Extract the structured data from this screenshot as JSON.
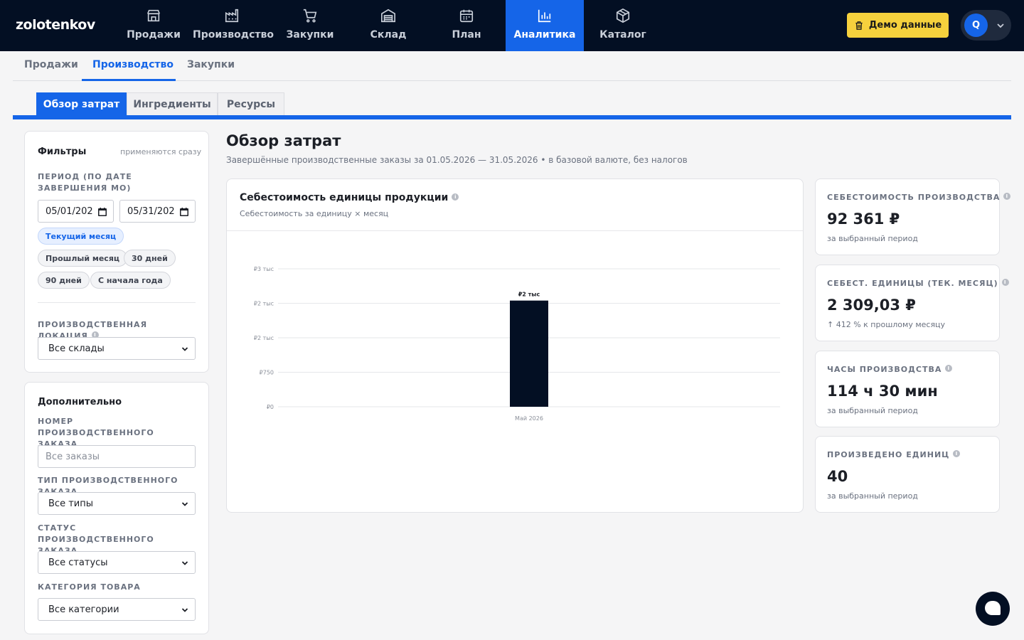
{
  "app": {
    "logo": "zolotenkov"
  },
  "nav": {
    "items": [
      {
        "label": "Продажи",
        "icon": "store-icon"
      },
      {
        "label": "Производство",
        "icon": "factory-icon"
      },
      {
        "label": "Закупки",
        "icon": "cart-icon"
      },
      {
        "label": "Склад",
        "icon": "warehouse-icon"
      },
      {
        "label": "План",
        "icon": "calendar-icon"
      },
      {
        "label": "Аналитика",
        "icon": "bar-chart-icon",
        "active": true
      },
      {
        "label": "Каталог",
        "icon": "box-icon"
      }
    ],
    "demo_button": "Демо данные",
    "user_initial": "Q"
  },
  "subtabs": [
    {
      "label": "Продажи"
    },
    {
      "label": "Производство",
      "active": true
    },
    {
      "label": "Закупки"
    }
  ],
  "tertabs": [
    {
      "label": "Обзор затрат",
      "active": true
    },
    {
      "label": "Ингредиенты"
    },
    {
      "label": "Ресурсы"
    }
  ],
  "filters": {
    "title": "Фильтры",
    "hint": "применяются сразу",
    "period_label": "ПЕРИОД (ПО ДАТЕ ЗАВЕРШЕНИЯ МО)",
    "date_from": "05/01/202",
    "date_to": "05/31/202",
    "presets": [
      {
        "label": "Текущий месяц",
        "active": true
      },
      {
        "label": "Прошлый месяц"
      },
      {
        "label": "30 дней"
      },
      {
        "label": "90 дней"
      },
      {
        "label": "С начала года"
      }
    ],
    "location_label": "ПРОИЗВОДСТВЕННАЯ ЛОКАЦИЯ",
    "location_value": "Все склады"
  },
  "extra": {
    "title": "Дополнительно",
    "order_number_label": "НОМЕР ПРОИЗВОДСТВЕННОГО ЗАКАЗА",
    "order_number_placeholder": "Все заказы",
    "order_type_label": "ТИП ПРОИЗВОДСТВЕННОГО ЗАКАЗА",
    "order_type_value": "Все типы",
    "order_status_label": "СТАТУС ПРОИЗВОДСТВЕННОГО ЗАКАЗА",
    "order_status_value": "Все статусы",
    "category_label": "КАТЕГОРИЯ ТОВАРА",
    "category_value": "Все категории"
  },
  "main": {
    "title": "Обзор затрат",
    "subtitle": "Завершённые производственные заказы за 01.05.2026 — 31.05.2026 • в базовой валюте, без налогов"
  },
  "chart_card": {
    "title": "Себестоимость единицы продукции",
    "subtitle": "Себестоимость за единицу × месяц"
  },
  "chart_data": {
    "type": "bar",
    "categories": [
      "Май 2026"
    ],
    "values": [
      2309.03
    ],
    "data_labels": [
      "₽2 тыс"
    ],
    "y_ticks": [
      0,
      750,
      1500,
      2250,
      3000
    ],
    "y_tick_labels": [
      "₽0",
      "₽750",
      "₽2 тыс",
      "₽2 тыс",
      "₽3 тыс"
    ],
    "ylim": [
      0,
      3000
    ],
    "grid": true,
    "bar_color": "#030f23"
  },
  "kpis": [
    {
      "label": "СЕБЕСТОИМОСТЬ ПРОИЗВОДСТВА",
      "value": "92 361 ₽",
      "note": "за выбранный период"
    },
    {
      "label": "СЕБЕСТ. ЕДИНИЦЫ (ТЕК. МЕСЯЦ)",
      "value": "2 309,03 ₽",
      "note": "↑ 412 % к прошлому месяцу"
    },
    {
      "label": "ЧАСЫ ПРОИЗВОДСТВА",
      "value": "114 ч 30 мин",
      "note": "за выбранный период"
    },
    {
      "label": "ПРОИЗВЕДЕНО ЕДИНИЦ",
      "value": "40",
      "note": "за выбранный период"
    }
  ],
  "colors": {
    "accent": "#1565e8",
    "nav_bg": "#030f23",
    "demo": "#f6d13d"
  }
}
